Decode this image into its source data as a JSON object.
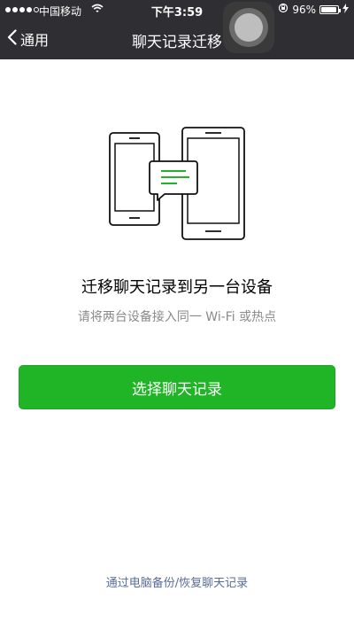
{
  "status_bar": {
    "carrier": "中国移动",
    "time": "下午3:59",
    "battery_percent": "96%",
    "battery_level": 0.96,
    "signal_bars_filled": 4,
    "signal_bars_total": 5
  },
  "nav": {
    "back_label": "通用",
    "title": "聊天记录迁移"
  },
  "main": {
    "headline": "迁移聊天记录到另一台设备",
    "subtext": "请将两台设备接入同一 Wi-Fi 或热点",
    "primary_button_label": "选择聊天记录"
  },
  "footer": {
    "link_label": "通过电脑备份/恢复聊天记录"
  },
  "colors": {
    "nav_background": "#2e2e33",
    "primary_green": "#20b526",
    "link_blue": "#5a6d96",
    "subtext_gray": "#8a8a8a"
  },
  "icons": [
    "signal-dots-icon",
    "wifi-icon",
    "rotation-lock-icon",
    "battery-icon",
    "charging-bolt-icon",
    "back-chevron-icon",
    "assistive-touch-icon",
    "phone-transfer-illustration"
  ]
}
